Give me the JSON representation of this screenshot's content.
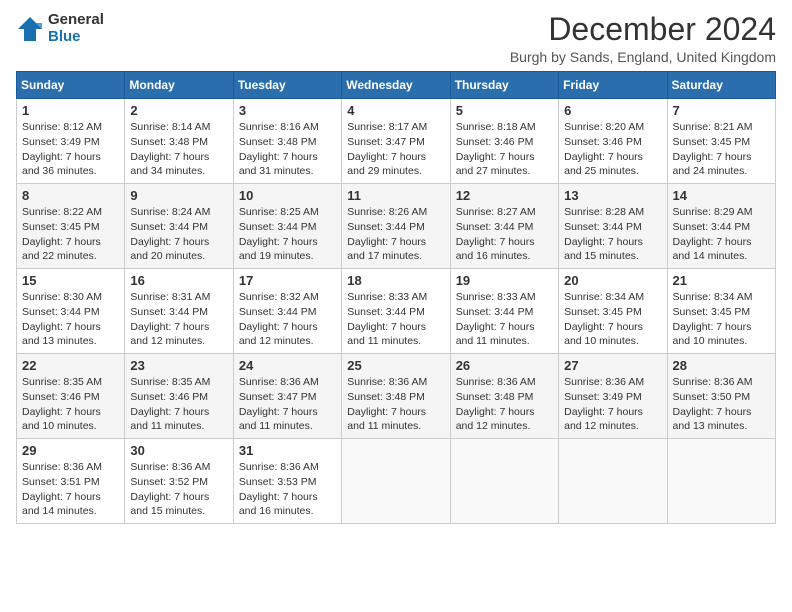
{
  "logo": {
    "general": "General",
    "blue": "Blue"
  },
  "title": "December 2024",
  "subtitle": "Burgh by Sands, England, United Kingdom",
  "headers": [
    "Sunday",
    "Monday",
    "Tuesday",
    "Wednesday",
    "Thursday",
    "Friday",
    "Saturday"
  ],
  "weeks": [
    [
      {
        "day": "1",
        "sunrise": "Sunrise: 8:12 AM",
        "sunset": "Sunset: 3:49 PM",
        "daylight": "Daylight: 7 hours and 36 minutes."
      },
      {
        "day": "2",
        "sunrise": "Sunrise: 8:14 AM",
        "sunset": "Sunset: 3:48 PM",
        "daylight": "Daylight: 7 hours and 34 minutes."
      },
      {
        "day": "3",
        "sunrise": "Sunrise: 8:16 AM",
        "sunset": "Sunset: 3:48 PM",
        "daylight": "Daylight: 7 hours and 31 minutes."
      },
      {
        "day": "4",
        "sunrise": "Sunrise: 8:17 AM",
        "sunset": "Sunset: 3:47 PM",
        "daylight": "Daylight: 7 hours and 29 minutes."
      },
      {
        "day": "5",
        "sunrise": "Sunrise: 8:18 AM",
        "sunset": "Sunset: 3:46 PM",
        "daylight": "Daylight: 7 hours and 27 minutes."
      },
      {
        "day": "6",
        "sunrise": "Sunrise: 8:20 AM",
        "sunset": "Sunset: 3:46 PM",
        "daylight": "Daylight: 7 hours and 25 minutes."
      },
      {
        "day": "7",
        "sunrise": "Sunrise: 8:21 AM",
        "sunset": "Sunset: 3:45 PM",
        "daylight": "Daylight: 7 hours and 24 minutes."
      }
    ],
    [
      {
        "day": "8",
        "sunrise": "Sunrise: 8:22 AM",
        "sunset": "Sunset: 3:45 PM",
        "daylight": "Daylight: 7 hours and 22 minutes."
      },
      {
        "day": "9",
        "sunrise": "Sunrise: 8:24 AM",
        "sunset": "Sunset: 3:44 PM",
        "daylight": "Daylight: 7 hours and 20 minutes."
      },
      {
        "day": "10",
        "sunrise": "Sunrise: 8:25 AM",
        "sunset": "Sunset: 3:44 PM",
        "daylight": "Daylight: 7 hours and 19 minutes."
      },
      {
        "day": "11",
        "sunrise": "Sunrise: 8:26 AM",
        "sunset": "Sunset: 3:44 PM",
        "daylight": "Daylight: 7 hours and 17 minutes."
      },
      {
        "day": "12",
        "sunrise": "Sunrise: 8:27 AM",
        "sunset": "Sunset: 3:44 PM",
        "daylight": "Daylight: 7 hours and 16 minutes."
      },
      {
        "day": "13",
        "sunrise": "Sunrise: 8:28 AM",
        "sunset": "Sunset: 3:44 PM",
        "daylight": "Daylight: 7 hours and 15 minutes."
      },
      {
        "day": "14",
        "sunrise": "Sunrise: 8:29 AM",
        "sunset": "Sunset: 3:44 PM",
        "daylight": "Daylight: 7 hours and 14 minutes."
      }
    ],
    [
      {
        "day": "15",
        "sunrise": "Sunrise: 8:30 AM",
        "sunset": "Sunset: 3:44 PM",
        "daylight": "Daylight: 7 hours and 13 minutes."
      },
      {
        "day": "16",
        "sunrise": "Sunrise: 8:31 AM",
        "sunset": "Sunset: 3:44 PM",
        "daylight": "Daylight: 7 hours and 12 minutes."
      },
      {
        "day": "17",
        "sunrise": "Sunrise: 8:32 AM",
        "sunset": "Sunset: 3:44 PM",
        "daylight": "Daylight: 7 hours and 12 minutes."
      },
      {
        "day": "18",
        "sunrise": "Sunrise: 8:33 AM",
        "sunset": "Sunset: 3:44 PM",
        "daylight": "Daylight: 7 hours and 11 minutes."
      },
      {
        "day": "19",
        "sunrise": "Sunrise: 8:33 AM",
        "sunset": "Sunset: 3:44 PM",
        "daylight": "Daylight: 7 hours and 11 minutes."
      },
      {
        "day": "20",
        "sunrise": "Sunrise: 8:34 AM",
        "sunset": "Sunset: 3:45 PM",
        "daylight": "Daylight: 7 hours and 10 minutes."
      },
      {
        "day": "21",
        "sunrise": "Sunrise: 8:34 AM",
        "sunset": "Sunset: 3:45 PM",
        "daylight": "Daylight: 7 hours and 10 minutes."
      }
    ],
    [
      {
        "day": "22",
        "sunrise": "Sunrise: 8:35 AM",
        "sunset": "Sunset: 3:46 PM",
        "daylight": "Daylight: 7 hours and 10 minutes."
      },
      {
        "day": "23",
        "sunrise": "Sunrise: 8:35 AM",
        "sunset": "Sunset: 3:46 PM",
        "daylight": "Daylight: 7 hours and 11 minutes."
      },
      {
        "day": "24",
        "sunrise": "Sunrise: 8:36 AM",
        "sunset": "Sunset: 3:47 PM",
        "daylight": "Daylight: 7 hours and 11 minutes."
      },
      {
        "day": "25",
        "sunrise": "Sunrise: 8:36 AM",
        "sunset": "Sunset: 3:48 PM",
        "daylight": "Daylight: 7 hours and 11 minutes."
      },
      {
        "day": "26",
        "sunrise": "Sunrise: 8:36 AM",
        "sunset": "Sunset: 3:48 PM",
        "daylight": "Daylight: 7 hours and 12 minutes."
      },
      {
        "day": "27",
        "sunrise": "Sunrise: 8:36 AM",
        "sunset": "Sunset: 3:49 PM",
        "daylight": "Daylight: 7 hours and 12 minutes."
      },
      {
        "day": "28",
        "sunrise": "Sunrise: 8:36 AM",
        "sunset": "Sunset: 3:50 PM",
        "daylight": "Daylight: 7 hours and 13 minutes."
      }
    ],
    [
      {
        "day": "29",
        "sunrise": "Sunrise: 8:36 AM",
        "sunset": "Sunset: 3:51 PM",
        "daylight": "Daylight: 7 hours and 14 minutes."
      },
      {
        "day": "30",
        "sunrise": "Sunrise: 8:36 AM",
        "sunset": "Sunset: 3:52 PM",
        "daylight": "Daylight: 7 hours and 15 minutes."
      },
      {
        "day": "31",
        "sunrise": "Sunrise: 8:36 AM",
        "sunset": "Sunset: 3:53 PM",
        "daylight": "Daylight: 7 hours and 16 minutes."
      },
      null,
      null,
      null,
      null
    ]
  ]
}
